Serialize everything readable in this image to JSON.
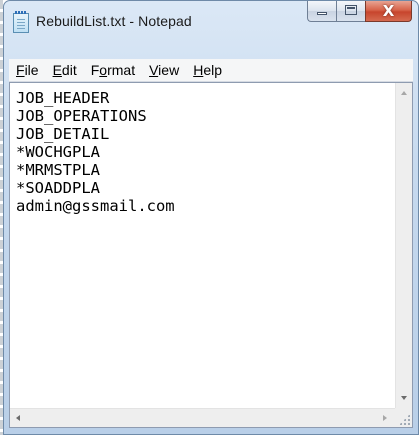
{
  "window": {
    "title": "RebuildList.txt - Notepad"
  },
  "caption_buttons": {
    "close_glyph": "X"
  },
  "menu": [
    {
      "label": "File",
      "mnemonic": "F",
      "rest": "ile"
    },
    {
      "label": "Edit",
      "mnemonic": "E",
      "rest": "dit"
    },
    {
      "label": "Format",
      "pre": "F",
      "mnemonic": "o",
      "rest": "rmat"
    },
    {
      "label": "View",
      "mnemonic": "V",
      "rest": "iew"
    },
    {
      "label": "Help",
      "mnemonic": "H",
      "rest": "elp"
    }
  ],
  "document": {
    "lines": [
      "JOB_HEADER",
      "JOB_OPERATIONS",
      "JOB_DETAIL",
      "*WOCHGPLA",
      "*MRMSTPLA",
      "*SOADDPLA",
      "admin@gssmail.com"
    ]
  },
  "colors": {
    "titlebar_gradient_top": "#dbe8f6",
    "close_button": "#c7452d",
    "menubar_bg": "#f5f6f7",
    "editor_bg": "#ffffff"
  }
}
